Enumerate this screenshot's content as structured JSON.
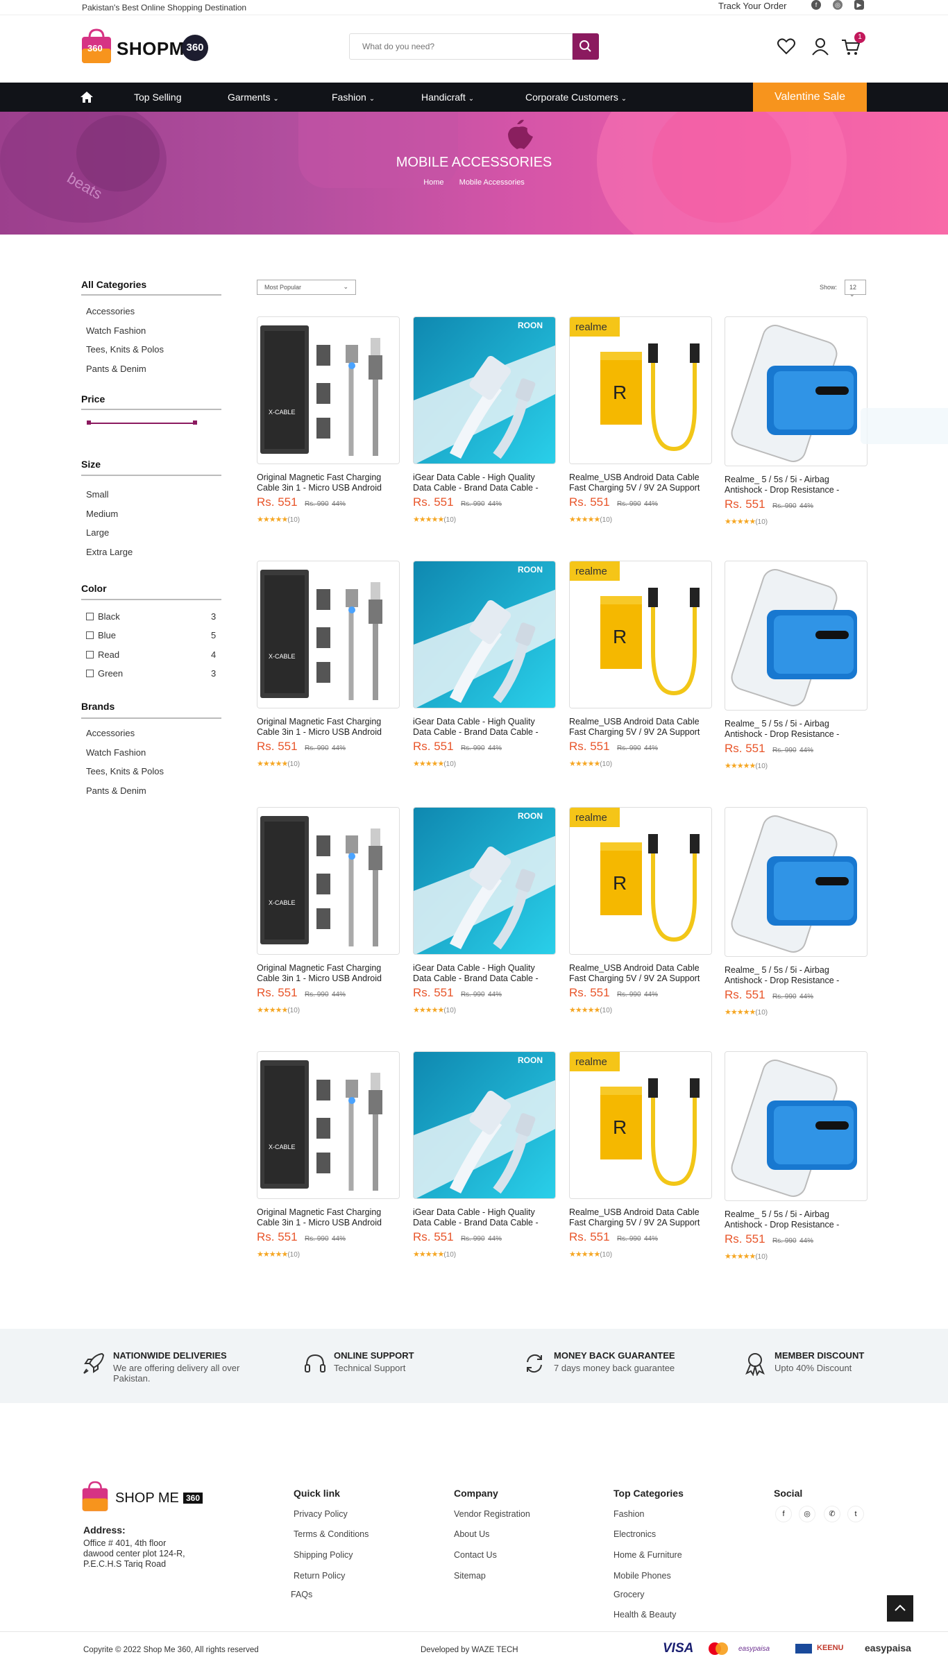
{
  "topbar": {
    "tagline": "Pakistan's Best Online Shopping Destination",
    "track": "Track Your Order",
    "social_icons": [
      "facebook-icon",
      "instagram-icon",
      "youtube-icon"
    ]
  },
  "header": {
    "logo_text": "SHOPME",
    "logo_badge": "360",
    "logo_bag_label": "360",
    "search_placeholder": "What do you need?",
    "cart_count": "1"
  },
  "nav": {
    "items": [
      "Top Selling",
      "Garments",
      "Fashion",
      "Handicraft",
      "Corporate Customers"
    ],
    "sale": "Valentine Sale"
  },
  "hero": {
    "title": "MOBILE ACCESSORIES",
    "crumb_home": "Home",
    "crumb_current": "Mobile Accessories"
  },
  "sidebar": {
    "categories_title": "All Categories",
    "categories": [
      "Accessories",
      "Watch Fashion",
      "Tees, Knits & Polos",
      "Pants & Denim"
    ],
    "price_title": "Price",
    "size_title": "Size",
    "sizes": [
      "Small",
      "Medium",
      "Large",
      "Extra Large"
    ],
    "color_title": "Color",
    "colors": [
      {
        "name": "Black",
        "count": "3"
      },
      {
        "name": "Blue",
        "count": "5"
      },
      {
        "name": "Read",
        "count": "4"
      },
      {
        "name": "Green",
        "count": "3"
      }
    ],
    "brands_title": "Brands",
    "brands": [
      "Accessories",
      "Watch Fashion",
      "Tees, Knits & Polos",
      "Pants & Denim"
    ]
  },
  "toolbar": {
    "sort": "Most Popular",
    "show_label": "Show:",
    "show_value": "12"
  },
  "products": [
    {
      "name1": "Original Magnetic Fast Charging",
      "name2": "Cable 3in 1 - Micro USB Android",
      "price": "Rs. 551",
      "old": "Rs. 990",
      "off": "44%",
      "reviews": "(10)",
      "brand": "",
      "img": "xcable"
    },
    {
      "name1": "iGear Data Cable - High Quality",
      "name2": "Data Cable - Brand Data Cable -",
      "price": "Rs. 551",
      "old": "Rs. 990",
      "off": "44%",
      "reviews": "(10)",
      "brand": "ROON",
      "img": "roon"
    },
    {
      "name1": "Realme_USB Android Data Cable",
      "name2": "Fast Charging 5V / 9V 2A Support",
      "price": "Rs. 551",
      "old": "Rs. 990",
      "off": "44%",
      "reviews": "(10)",
      "brand": "realme",
      "img": "realme"
    },
    {
      "name1": "Realme_ 5 / 5s / 5i - Airbag",
      "name2": "Antishock - Drop Resistance -",
      "price": "Rs. 551",
      "old": "Rs. 990",
      "off": "44%",
      "reviews": "(10)",
      "brand": "",
      "img": "case"
    }
  ],
  "features": [
    {
      "title": "NATIONWIDE DELIVERIES",
      "sub": "We are offering delivery all over Pakistan.",
      "icon": "rocket-icon"
    },
    {
      "title": "ONLINE SUPPORT",
      "sub": "Technical Support",
      "icon": "headset-icon"
    },
    {
      "title": "MONEY BACK GUARANTEE",
      "sub": "7 days money back guarantee",
      "icon": "refresh-icon"
    },
    {
      "title": "MEMBER DISCOUNT",
      "sub": "Upto 40% Discount",
      "icon": "medal-icon"
    }
  ],
  "footer": {
    "logo_text": "SHOP ME",
    "logo_badge": "360",
    "address_title": "Address:",
    "address_lines": [
      "Office # 401, 4th floor",
      "dawood center plot 124-R,",
      "P.E.C.H.S Tariq Road"
    ],
    "quick_title": "Quick link",
    "quick_links": [
      "Privacy Policy",
      "Terms & Conditions",
      "Shipping Policy",
      "Return Policy",
      "FAQs"
    ],
    "company_title": "Company",
    "company_links": [
      "Vendor Registration",
      "About Us",
      "Contact Us",
      "Sitemap"
    ],
    "cat_title": "Top Categories",
    "cat_links": [
      "Fashion",
      "Electronics",
      "Home & Furniture",
      "Mobile Phones",
      "Grocery",
      "Health & Beauty"
    ],
    "social_title": "Social",
    "social": [
      "f",
      "◎",
      "✆",
      "t"
    ],
    "copyright": "Copyrite © 2022 Shop Me 360, All rights reserved",
    "developed": "Developed by WAZE TECH",
    "payments": [
      "VISA",
      "easypaisa",
      "KEENU",
      "easypaisa"
    ]
  },
  "colors": {
    "brand": "#8b1a5f",
    "price": "#e8552a",
    "sale": "#f7941d",
    "nav_bg": "#111318"
  }
}
